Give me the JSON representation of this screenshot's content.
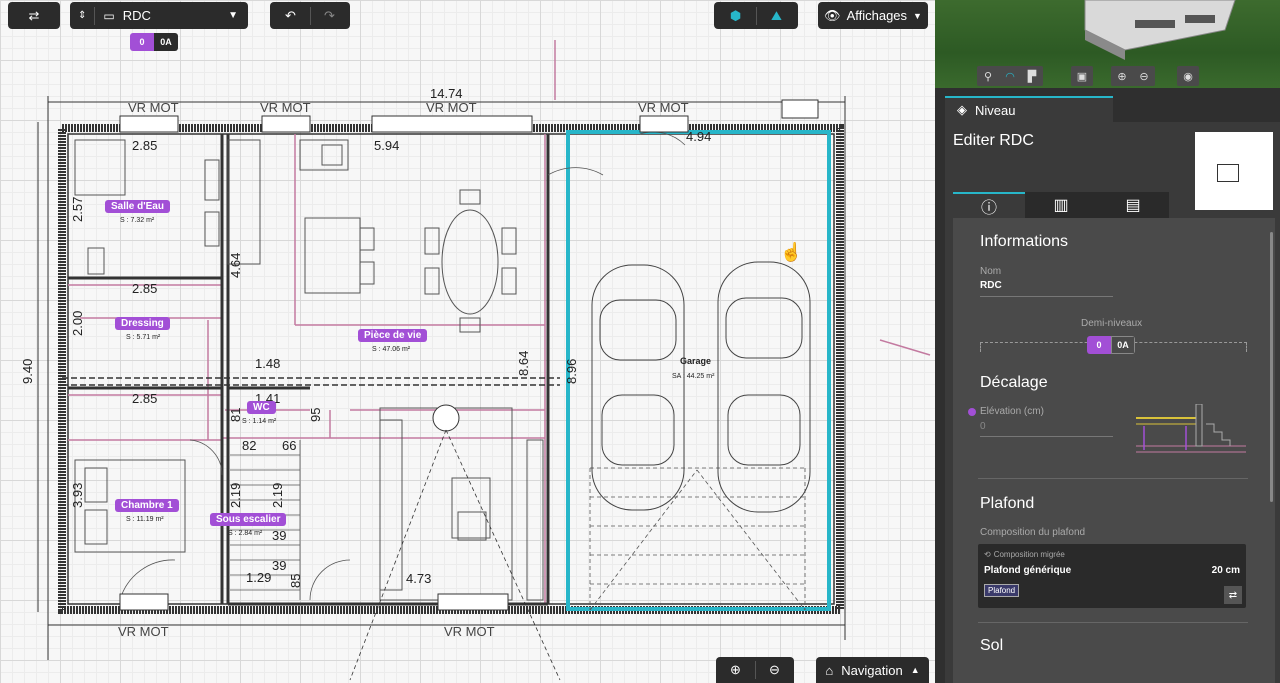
{
  "toolbar": {
    "level_name": "RDC",
    "displays_label": "Affichages",
    "half_levels": {
      "active": "0",
      "inactive": "0A"
    }
  },
  "navigation": {
    "label": "Navigation"
  },
  "plan": {
    "dims": {
      "total_width": "14.74",
      "d_594": "5.94",
      "d_494": "4.94",
      "d_285a": "2.85",
      "d_285b": "2.85",
      "d_285c": "2.85",
      "d_257": "2.57",
      "d_464": "4.64",
      "d_200": "2.00",
      "d_148": "1.48",
      "d_141": "1.41",
      "d_081": "81",
      "d_095": "95",
      "d_082": "82",
      "d_066": "66",
      "d_393": "3.93",
      "d_219a": "2.19",
      "d_219b": "2.19",
      "d_039": "39",
      "d_039b": "39",
      "d_129": "1.29",
      "d_085": "85",
      "d_473": "4.73",
      "d_940": "9.40",
      "d_864": "8.64",
      "d_896": "8.96"
    },
    "vr_mot": "VR MOT",
    "rooms": [
      {
        "name": "Salle d'Eau",
        "area": "S : 7.32 m²"
      },
      {
        "name": "Dressing",
        "area": "S : 5.71 m²"
      },
      {
        "name": "Pièce de vie",
        "area": "S : 47.06 m²"
      },
      {
        "name": "WC",
        "area": "S : 1.14 m²"
      },
      {
        "name": "Chambre 1",
        "area": "S : 11.19 m²"
      },
      {
        "name": "Sous escalier",
        "area": "S : 2.84 m²"
      }
    ],
    "garage": {
      "name": "Garage",
      "area": "SA : 44.25 m²"
    }
  },
  "panel": {
    "tab_label": "Niveau",
    "title": "Editer RDC",
    "info": {
      "title": "Informations",
      "name_label": "Nom",
      "name_value": "RDC",
      "half_levels_label": "Demi-niveaux",
      "half_active": "0",
      "half_inactive": "0A"
    },
    "offset": {
      "title": "Décalage",
      "elevation_label": "Elévation (cm)",
      "elevation_value": "0"
    },
    "ceiling": {
      "title": "Plafond",
      "composition_label": "Composition du plafond",
      "migrated_label": "Composition migrée",
      "name": "Plafond générique",
      "thickness": "20 cm",
      "tag": "Plafond"
    },
    "floor": {
      "title": "Sol"
    }
  },
  "colors": {
    "accent": "#a24fd6",
    "teal": "#27b6c9",
    "wall": "#333333",
    "pink_line": "#c37aa0"
  }
}
